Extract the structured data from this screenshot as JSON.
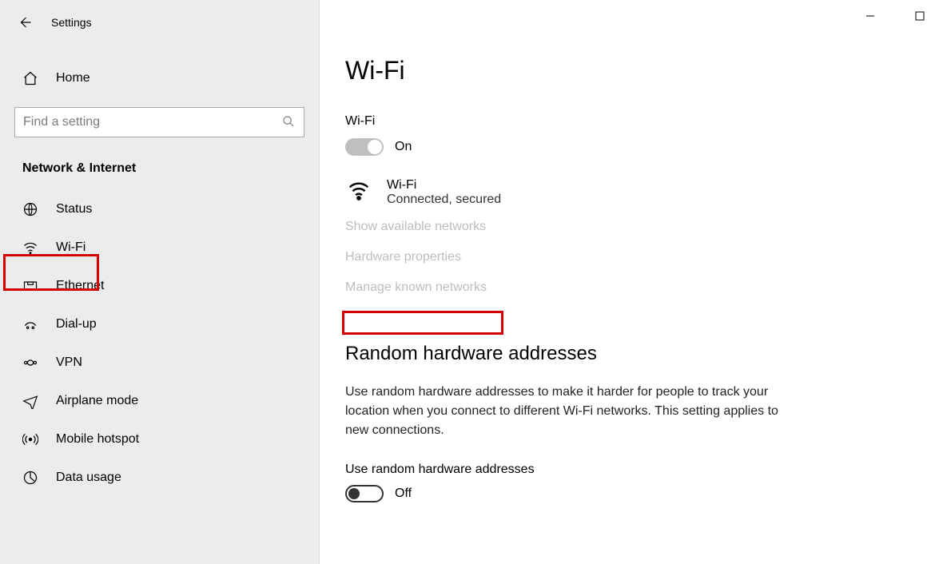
{
  "titlebar": {
    "title": "Settings"
  },
  "sidebar": {
    "home": "Home",
    "search_placeholder": "Find a setting",
    "section": "Network & Internet",
    "items": [
      {
        "label": "Status"
      },
      {
        "label": "Wi-Fi"
      },
      {
        "label": "Ethernet"
      },
      {
        "label": "Dial-up"
      },
      {
        "label": "VPN"
      },
      {
        "label": "Airplane mode"
      },
      {
        "label": "Mobile hotspot"
      },
      {
        "label": "Data usage"
      }
    ]
  },
  "main": {
    "title": "Wi-Fi",
    "wifi_label": "Wi-Fi",
    "wifi_toggle_state": "On",
    "network": {
      "name": "Wi-Fi",
      "status": "Connected, secured"
    },
    "links": {
      "show_available": "Show available networks",
      "hardware_props": "Hardware properties",
      "manage_known": "Manage known networks"
    },
    "random_section": {
      "heading": "Random hardware addresses",
      "description": "Use random hardware addresses to make it harder for people to track your location when you connect to different Wi-Fi networks. This setting applies to new connections.",
      "toggle_label": "Use random hardware addresses",
      "toggle_state": "Off"
    }
  }
}
